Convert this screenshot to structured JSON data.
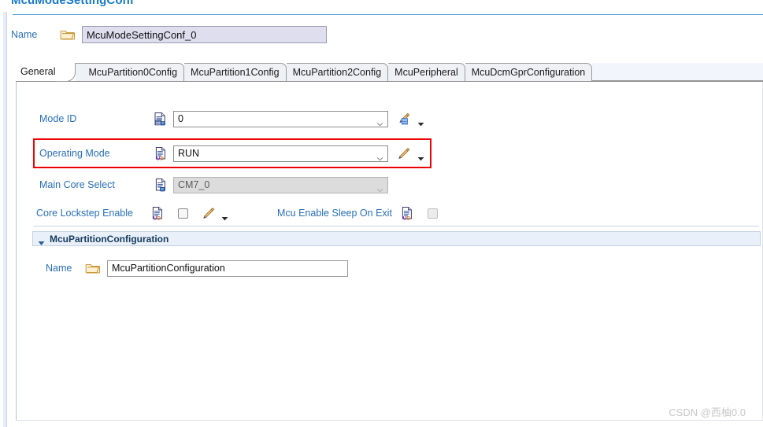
{
  "editor": {
    "title": "McuModeSettingConf"
  },
  "name_row": {
    "label": "Name",
    "icon": "folder-icon",
    "value": "McuModeSettingConf_0",
    "placeholder": ""
  },
  "tabs": [
    {
      "label": "General",
      "selected": true
    },
    {
      "label": "McuPartition0Config",
      "selected": false
    },
    {
      "label": "McuPartition1Config",
      "selected": false
    },
    {
      "label": "McuPartition2Config",
      "selected": false
    },
    {
      "label": "McuPeripheral",
      "selected": false
    },
    {
      "label": "McuDcmGprConfiguration",
      "selected": false
    }
  ],
  "fields": {
    "mode_id": {
      "label": "Mode ID",
      "type_icon": "doc-c-icon",
      "value": "0",
      "edit_icon": "pencil-calc-icon",
      "menu_icon": "chevron-down-icon"
    },
    "operating_mode": {
      "label": "Operating Mode",
      "type_icon": "doc-ud-icon",
      "value": "RUN",
      "edit_icon": "pencil-icon",
      "menu_icon": "chevron-down-icon",
      "highlighted": true
    },
    "main_core_select": {
      "label": "Main Core Select",
      "type_icon": "doc-c-icon",
      "value": "CM7_0",
      "disabled": true
    },
    "core_lockstep_enable": {
      "label": "Core Lockstep Enable",
      "type_icon": "doc-ud-icon",
      "checked": false,
      "edit_icon": "pencil-icon",
      "menu_icon": "chevron-down-icon"
    },
    "mcu_enable_sleep_on_exit": {
      "label": "Mcu Enable Sleep On Exit",
      "type_icon": "doc-ud-icon",
      "checked": false,
      "disabled": true
    }
  },
  "section": {
    "twisty_icon": "triangle-down-icon",
    "title": "McuPartitionConfiguration",
    "name_label": "Name",
    "name_icon": "folder-icon",
    "name_value": "McuPartitionConfiguration"
  },
  "watermark": {
    "text": "CSDN @西柚0.0"
  },
  "colors": {
    "label_blue": "#2a6fb5",
    "title_blue": "#1a7ac4",
    "highlight_red": "#ee0000",
    "section_bg": "#e9f0fa",
    "name_field_bg": "#dedeef"
  }
}
